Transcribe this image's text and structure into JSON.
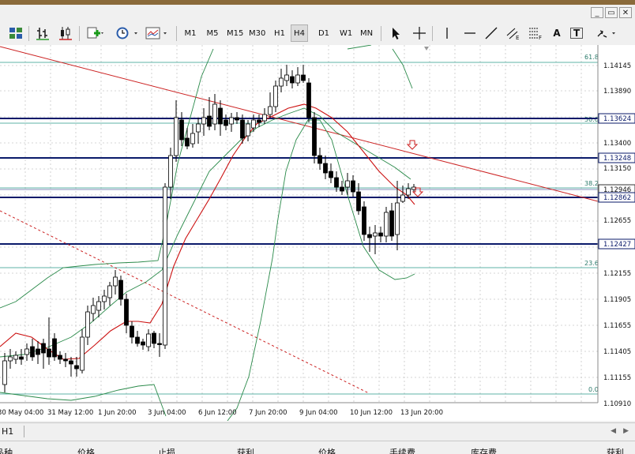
{
  "window": {
    "minimize_label": "_",
    "restore_label": "▭",
    "close_label": "✕"
  },
  "toolbar": {
    "timeframes": [
      "M1",
      "M5",
      "M15",
      "M30",
      "H1",
      "H4",
      "D1",
      "W1",
      "MN"
    ],
    "active_timeframe": "H4",
    "draw_text_label": "A",
    "draw_textlabel_label": "T"
  },
  "chart": {
    "tab_label": "H1",
    "price_labels": [
      "1.14145",
      "1.13890",
      "1.13400",
      "1.13150",
      "1.12655",
      "1.12155",
      "1.11905",
      "1.11655",
      "1.11405",
      "1.11155",
      "1.10910"
    ],
    "hlines": [
      {
        "price": "1.13624"
      },
      {
        "price": "1.13248"
      },
      {
        "price": "1.12946"
      },
      {
        "price": "1.12862"
      },
      {
        "price": "1.12427"
      }
    ],
    "fibo_levels": [
      "61.8",
      "50.0",
      "38.2",
      "23.6",
      "0.0"
    ],
    "time_labels": [
      "30 May 04:00",
      "31 May 12:00",
      "1 Jun 20:00",
      "3 Jun 04:00",
      "6 Jun 12:00",
      "7 Jun 20:00",
      "9 Jun 04:00",
      "10 Jun 12:00",
      "13 Jun 20:00"
    ]
  },
  "bottom": {
    "columns": [
      "品种",
      "价格",
      "止损",
      "获利",
      "价格",
      "手续费",
      "库存费",
      "获利"
    ]
  }
}
